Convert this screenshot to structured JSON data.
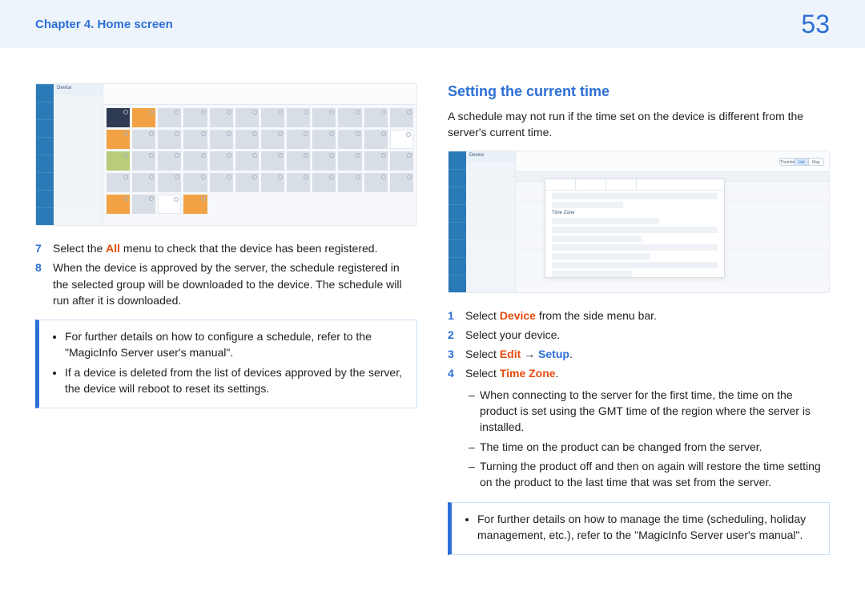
{
  "header": {
    "chapter": "Chapter 4. Home screen",
    "page_number": "53"
  },
  "left": {
    "step7": {
      "num": "7",
      "pre": "Select the ",
      "hl": "All",
      "post": " menu to check that the device has been registered."
    },
    "step8": {
      "num": "8",
      "text": "When the device is approved by the server, the schedule registered in the selected group will be downloaded to the device. The schedule will run after it is downloaded."
    },
    "note": {
      "b1": "For further details on how to configure a schedule, refer to the \"MagicInfo Server user's manual\".",
      "b2": "If a device is deleted from the list of devices approved by the server, the device will reboot to reset its settings."
    },
    "mock": {
      "panel_title": "Device"
    }
  },
  "right": {
    "heading": "Setting the current time",
    "intro": "A schedule may not run if the time set on the device is different from the server's current time.",
    "mock": {
      "panel_title": "Device",
      "modal_field": "Time Zone",
      "togglebar": {
        "opt1": "Thumbnail",
        "opt2": "List",
        "opt3": "Map"
      }
    },
    "s1": {
      "num": "1",
      "pre": "Select ",
      "hl": "Device",
      "post": " from the side menu bar."
    },
    "s2": {
      "num": "2",
      "text": "Select your device."
    },
    "s3": {
      "num": "3",
      "pre": "Select ",
      "hl": "Edit",
      "arrow": " → ",
      "link": "Setup",
      "post": "."
    },
    "s4": {
      "num": "4",
      "pre": "Select ",
      "hl": "Time Zone",
      "post": "."
    },
    "d1": "When connecting to the server for the first time, the time on the product is set using the GMT time of the region where the server is installed.",
    "d2": "The time on the product can be changed from the server.",
    "d3": "Turning the product off and then on again will restore the time setting on the product to the last time that was set from the server.",
    "note": {
      "b1": "For further details on how to manage the time (scheduling, holiday management, etc.), refer to the \"MagicInfo Server user's manual\"."
    }
  }
}
